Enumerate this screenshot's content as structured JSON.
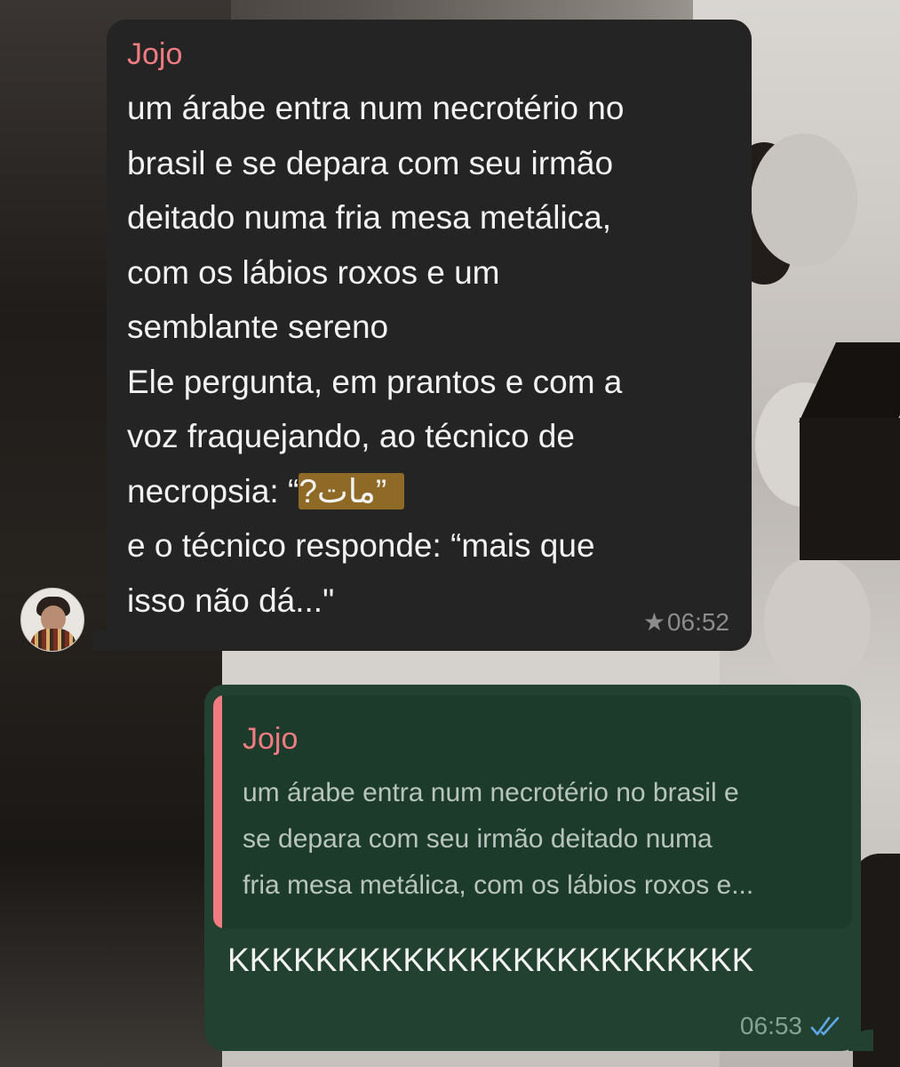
{
  "chat": {
    "incoming": {
      "sender": "Jojo",
      "lines": [
        "um árabe entra num necrotério no",
        "brasil e se depara com seu irmão",
        "deitado numa fria mesa metálica,",
        "com os lábios roxos e um",
        "semblante sereno",
        "Ele pergunta, em prantos e com a",
        "voz fraquejando, ao técnico de"
      ],
      "question_prefix": "necropsia: “",
      "question_arabic": "مات?",
      "question_suffix": "”",
      "answer_lines": [
        "e o técnico responde: “mais que",
        "isso não dá...\""
      ],
      "star_icon": "star-icon",
      "starred": true,
      "time": "06:52"
    },
    "outgoing": {
      "quote": {
        "sender": "Jojo",
        "lines": [
          "um árabe entra num necrotério no brasil e",
          "se depara com seu irmão deitado numa",
          "fria mesa metálica, com os lábios roxos e..."
        ]
      },
      "text": "KKKKKKKKKKKKKKKKKKKKKKKK",
      "time": "06:53",
      "status_icon": "double-check-icon",
      "status": "read"
    }
  },
  "colors": {
    "incoming_bubble": "#242424",
    "outgoing_bubble": "#234131",
    "quote_bg": "#1c3b2a",
    "sender_name": "#f07b81",
    "highlight": "#8f6a26",
    "read_ticks": "#5fa8e8"
  }
}
